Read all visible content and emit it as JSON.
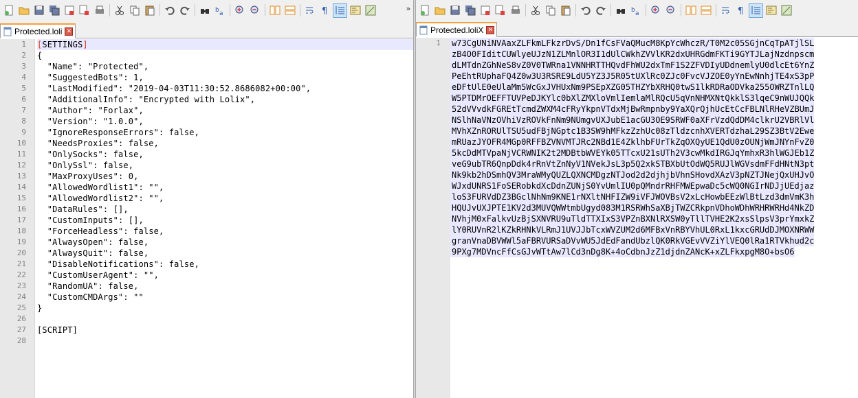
{
  "left": {
    "tab_label": "Protected.loli",
    "lines": [
      "[SETTINGS]",
      "{",
      "  \"Name\": \"Protected\",",
      "  \"SuggestedBots\": 1,",
      "  \"LastModified\": \"2019-04-03T11:30:52.8686082+00:00\",",
      "  \"AdditionalInfo\": \"Encrypted with Lolix\",",
      "  \"Author\": \"Forlax\",",
      "  \"Version\": \"1.0.0\",",
      "  \"IgnoreResponseErrors\": false,",
      "  \"NeedsProxies\": false,",
      "  \"OnlySocks\": false,",
      "  \"OnlySsl\": false,",
      "  \"MaxProxyUses\": 0,",
      "  \"AllowedWordlist1\": \"\",",
      "  \"AllowedWordlist2\": \"\",",
      "  \"DataRules\": [],",
      "  \"CustomInputs\": [],",
      "  \"ForceHeadless\": false,",
      "  \"AlwaysOpen\": false,",
      "  \"AlwaysQuit\": false,",
      "  \"DisableNotifications\": false,",
      "  \"CustomUserAgent\": \"\",",
      "  \"RandomUA\": false,",
      "  \"CustomCMDArgs\": \"\"",
      "}",
      "",
      "[SCRIPT]",
      ""
    ],
    "line_numbers": [
      "1",
      "2",
      "3",
      "4",
      "5",
      "6",
      "7",
      "8",
      "9",
      "10",
      "11",
      "12",
      "13",
      "14",
      "15",
      "16",
      "17",
      "18",
      "19",
      "20",
      "21",
      "22",
      "23",
      "24",
      "25",
      "26",
      "27",
      "28"
    ]
  },
  "right": {
    "tab_label": "Protected.loliX",
    "line_number": "1",
    "wrapped_lines": [
      "w73CgUNiNVAaxZLFkmLFkzrDvS/Dn1fCsFVaQMucM8KpYcWhczR/T0M2c05SGjnCqTpATjlSL",
      "zB4O0FIditCUWlyeUJzN1ZLMnlOR3I1dUlCWkhZVVlKR2dxUHRGdmFKTi9GYTJLajNzdnpscm",
      "dLMTdnZGhNeS8vZ0V0TWRna1VNNHRTTHQvdFhWU2dxTmF1S2ZFVDIyUDdnemlyU0dlcEt6YnZ",
      "PeEhtRUphaFQ4Z0w3U3RSRE9LdU5YZ3J5R05tUXlRc0ZJc0FvcVJZOE0yYnEwNnhjTE4xS3pP",
      "eDFtUlE0eUlaMm5WcGxJVHUxNm9PSEpXZG05THZYbXRHQ0twS1lkRDRaODVka255OWRZTnlLQ",
      "W5PTDMrOEFFTUVPeDJKYlc0bXlZMXloVmlIemlaMlRQcU5qVnNHMXNtQkklS3lqeC9nWUJQQk",
      "52dVVvdkFGREtTcmdZWXM4cFRyYkpnVTdxMjBwRmpnby9YaXQrQjhUcEtCcFBLNlRHeVZBUmJ",
      "NSlhNaVNzOVhiVzROVkFnNm9NUmgvUXJubE1acGU3OE9SRWF0aXFrVzdQdDM4clkrU2VBRlVl",
      "MVhXZnRORUlTSU5udFBjNGptc1B3SW9hMFkzZzhUc08zTldzcnhXVERTdzhaL29SZ3BtV2Ewe",
      "mRUazJYOFR4MGp0RFFBZVNVMTJRc2NBd1E4ZklhbFUrTkZqOXQyUE1QdU0zOUNjWmJNYnFvZ0",
      "5kcDdMTVpaNjVCRWNIK2t2MDBtbWVEYk05TTcxU21sUTh2V3cwMkdIRGJqYmhxR3hlWGJEb1Z",
      "veG9ubTR6QnpDdk4rRnVtZnNyV1NVekJsL3p5Q2xkSTBXbUtOdWQ5RUJlWGVsdmFFdHNtN3pt",
      "Nk9kb2hDSmhQV3MraWMyQUZLQXNCMDgzNTJod2d2djhjbVhnSHovdXAzV3pNZTJNejQxUHJvO",
      "WJxdUNRS1FoSERobkdXcDdnZUNjS0YvUmlIU0pQMndrRHFMWEpwaDc5cWQ0NGIrNDJjUEdjaz",
      "loS3FURVdDZ3BGclNhNm9KNE1rNXltNHFIZW9iVFJWOVBsV2xLcHowbEEzWlBtLzd3dmVmK3h",
      "HQUJvUXJPTE1KV2d3MUVQWWtmbUgyd083M1RSRWhSaXBjTWZCRkpnVDhoWDhWRHRWRHd4NkZD",
      "NVhjM0xFalkvUzBjSXNVRU9uTldTTXIxS3VPZnBXNlRXSW0yTllTVHE2K2xsSlpsV3prYmxkZ",
      "lY0RUVnR2lKZkRHNkVLRmJ1UVJJbTcxWVZUM2d6MFBxVnRBYVhUL0RxL1kxcGRUdDJMOXNRWW",
      "granVnaDBVWWl5aFBRVURSaDVvWU5JdEdFandUbzlQK0RkVGEvVVZiYlVEQ0lRa1RTVkhud2c",
      "9PXg7MDVncFfCsGJvWTtAw7lCd3nDg8K+4oCdbnJzZ1djdnZANcK+xZLFkxpgM8O+bsO6"
    ]
  },
  "toolbar_icons": [
    "new-file-icon",
    "open-folder-icon",
    "save-icon",
    "save-all-icon",
    "close-icon",
    "close-all-icon",
    "print-icon",
    "cut-icon",
    "copy-icon",
    "paste-icon",
    "undo-icon",
    "redo-icon",
    "find-icon",
    "replace-icon",
    "zoom-in-icon",
    "zoom-out-icon",
    "sync-vertical-icon",
    "sync-horizontal-icon",
    "word-wrap-icon",
    "show-all-chars-icon",
    "indent-guide-icon",
    "doc-map-icon",
    "function-list-icon"
  ],
  "colors": {
    "accent_tab": "#f6a13b",
    "current_line": "#e8e8ff",
    "gutter": "#e8e8e8",
    "bracket_highlight": "#d93a1d"
  }
}
